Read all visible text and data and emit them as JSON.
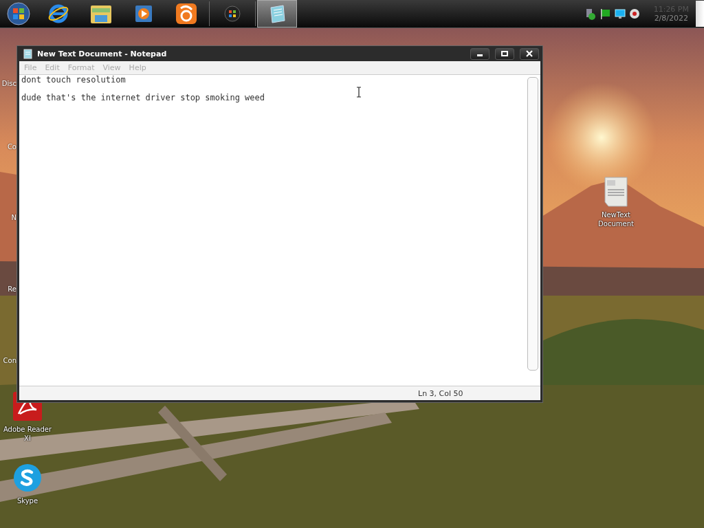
{
  "taskbar": {
    "apps": [
      {
        "kind": "ie",
        "selected": false
      },
      {
        "kind": "folder",
        "selected": false
      },
      {
        "kind": "media",
        "selected": false
      },
      {
        "kind": "uc",
        "selected": false
      },
      {
        "kind": "mediacenter",
        "selected": false
      },
      {
        "kind": "notepad",
        "selected": true
      }
    ],
    "clock": {
      "time": "11:26 PM",
      "date": "2/8/2022"
    }
  },
  "desktop_icons_left": [
    {
      "label": "Disc"
    },
    {
      "label": "Co"
    },
    {
      "label": "N"
    },
    {
      "label": "Re"
    },
    {
      "label": "Con"
    }
  ],
  "desktop_icons": [
    {
      "label": "Adobe Reader XI",
      "kind": "pdf"
    },
    {
      "label": "Skype",
      "kind": "skype"
    }
  ],
  "desktop_file": {
    "label": "NewText Document",
    "kind": "textfile"
  },
  "window": {
    "title": "New Text Document - Notepad",
    "menu": [
      {
        "label": "File",
        "disabled": true
      },
      {
        "label": "Edit",
        "disabled": true
      },
      {
        "label": "Format",
        "disabled": true
      },
      {
        "label": "View",
        "disabled": true
      },
      {
        "label": "Help",
        "disabled": true
      }
    ],
    "lines": [
      "dont touch resolutiom",
      "dude that's the internet driver stop smoking weed"
    ],
    "status_bar": "Ln 3, Col 50"
  }
}
